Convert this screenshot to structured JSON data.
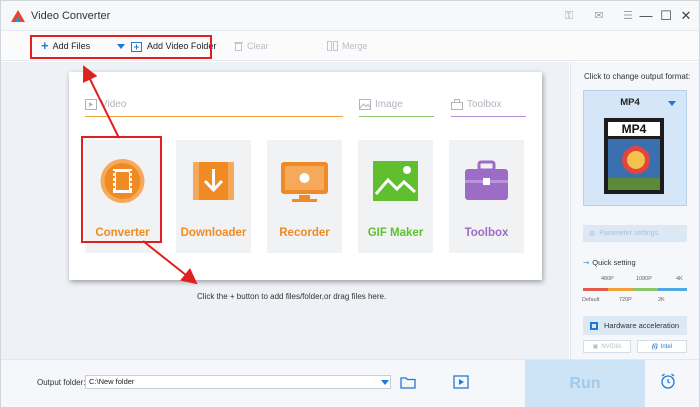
{
  "window": {
    "title": "Video Converter",
    "controls": {
      "minimize": "—",
      "maximize": "☐",
      "close": "✕"
    }
  },
  "toolbar": {
    "add_files_label": "Add Files",
    "add_folder_label": "Add Video Folder",
    "clear_label": "Clear",
    "merge_label": "Merge"
  },
  "sections": {
    "video": "Video",
    "image": "Image",
    "toolbox": "Toolbox"
  },
  "tools": [
    {
      "label": "Converter",
      "color": "#f08a24"
    },
    {
      "label": "Downloader",
      "color": "#f08a24"
    },
    {
      "label": "Recorder",
      "color": "#f08a24"
    },
    {
      "label": "GIF Maker",
      "color": "#5fbf2f"
    },
    {
      "label": "Toolbox",
      "color": "#9c6cc7"
    }
  ],
  "hint": "Click the + button to add files/folder,or drag files here.",
  "side": {
    "title": "Click to change output format:",
    "format": "MP4",
    "format_badge": "MP4",
    "param_label": "Parameter settings",
    "quick_label": "Quick setting",
    "slider_top": [
      "480P",
      "1080P",
      "4K"
    ],
    "slider_bottom": [
      "Default",
      "720P",
      "2K"
    ],
    "hw_label": "Hardware acceleration",
    "gpu_nvidia": "NVIDIA",
    "gpu_intel": "Intel"
  },
  "bottom": {
    "output_label": "Output folder:",
    "output_value": "C:\\New folder",
    "run_label": "Run"
  },
  "colors": {
    "accent": "#1e7ad6",
    "highlight": "#e02020",
    "video_line": "#f0a23a",
    "image_line": "#8cc56a",
    "toolbox_line": "#b48fd9"
  }
}
